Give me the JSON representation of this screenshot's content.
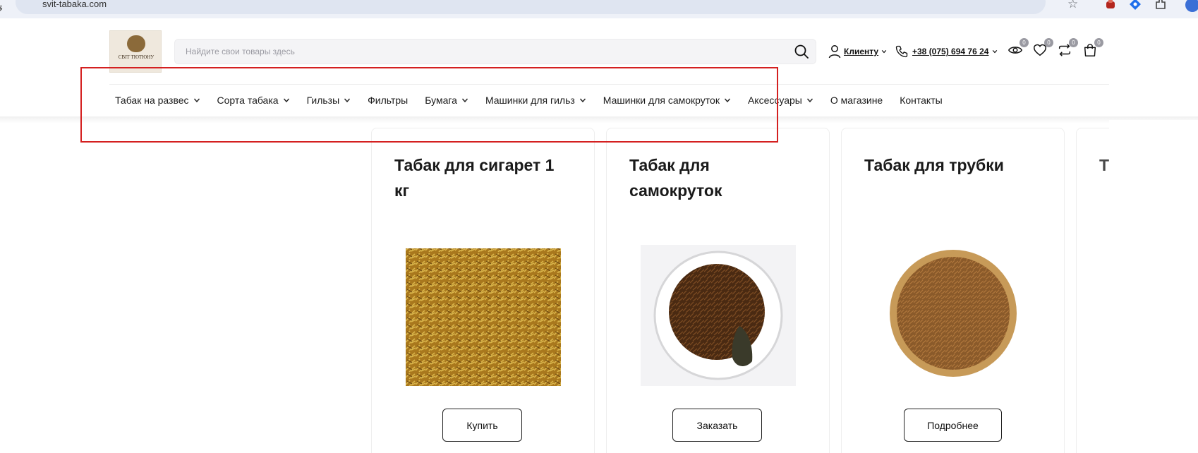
{
  "browser": {
    "url": "svit-tabaka.com",
    "icons": [
      "site-info-icon",
      "star-icon",
      "extension-icon",
      "puzzle-icon",
      "profile-icon"
    ]
  },
  "header": {
    "logo_text": "СВIТ ТЮТЮНУ",
    "search": {
      "placeholder": "Найдите свои товары здесь"
    },
    "account_label": "Клиенту",
    "phone": "+38 (075) 694 76 24",
    "counters": {
      "viewed": "0",
      "wishlist": "0",
      "compare": "0",
      "cart": "0"
    }
  },
  "nav": {
    "items": [
      {
        "label": "Табак на развес",
        "has_dropdown": true
      },
      {
        "label": "Сорта табака",
        "has_dropdown": true
      },
      {
        "label": "Гильзы",
        "has_dropdown": true
      },
      {
        "label": "Фильтры",
        "has_dropdown": false
      },
      {
        "label": "Бумага",
        "has_dropdown": true
      },
      {
        "label": "Машинки для гильз",
        "has_dropdown": true
      },
      {
        "label": "Машинки для самокруток",
        "has_dropdown": true
      },
      {
        "label": "Аксессуары",
        "has_dropdown": true
      },
      {
        "label": "О магазине",
        "has_dropdown": false
      },
      {
        "label": "Контакты",
        "has_dropdown": false
      }
    ]
  },
  "cards": [
    {
      "title": "Табак для сигарет 1 кг",
      "button": "Купить",
      "image": "loose-tobacco-photo"
    },
    {
      "title": "Табак для самокруток",
      "button": "Заказать",
      "image": "tobacco-plate-with-pipe-photo"
    },
    {
      "title": "Табак для трубки",
      "button": "Подробнее",
      "image": "tobacco-wooden-bowl-photo"
    },
    {
      "title": "Т"
    }
  ],
  "colors": {
    "highlight": "#d42020",
    "accent_text": "#1a1a1a",
    "badge": "#9a9aa2"
  }
}
